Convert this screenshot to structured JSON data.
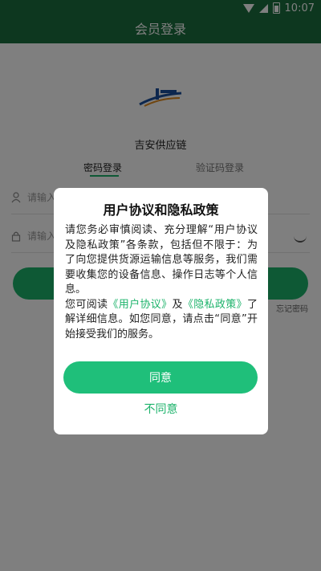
{
  "status": {
    "time": "10:07"
  },
  "header": {
    "title": "会员登录"
  },
  "login": {
    "company": "吉安供应链",
    "tabs": [
      "密码登录",
      "验证码登录"
    ],
    "username_placeholder": "请输入",
    "password_placeholder": "请输入",
    "login_label": "",
    "forgot_label": "忘记密码"
  },
  "dialog": {
    "title": "用户协议和隐私政策",
    "paragraph1": "请您务必审慎阅读、充分理解“用户协议及隐私政策”各条款，包括但不限于：为了向您提供货源运输信息等服务，我们需要收集您的设备信息、操作日志等个人信息。",
    "p2_prefix": "您可阅读",
    "user_agreement": "《用户协议》",
    "p2_and": "及",
    "privacy_policy": "《隐私政策》",
    "p2_suffix": "了解详细信息。如您同意，请点击“同意”开始接受我们的服务。",
    "agree_label": "同意",
    "disagree_label": "不同意"
  },
  "colors": {
    "header": "#1b6e3e",
    "accent": "#1db36b",
    "button": "#1fbf7a"
  }
}
